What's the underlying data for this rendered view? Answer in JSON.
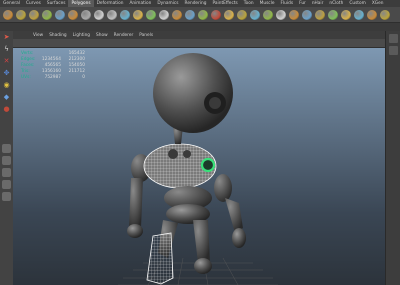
{
  "menu_tabs": [
    "General",
    "Curves",
    "Surfaces",
    "Polygons",
    "Deformation",
    "Animation",
    "Dynamics",
    "Rendering",
    "PaintEffects",
    "Toon",
    "Muscle",
    "Fluids",
    "Fur",
    "nHair",
    "nCloth",
    "Custom",
    "XGen"
  ],
  "active_tab_index": 3,
  "shelf_icon_colors": [
    "#c78a3a",
    "#b9a33c",
    "#bca040",
    "#8fb648",
    "#6aa0c9",
    "#c78a3a",
    "#a9a9a9",
    "#d0d0d0",
    "#bfbfbf",
    "#67b0cd",
    "#d8b14a",
    "#7fbf5a",
    "#d0d0d0",
    "#c78a3a",
    "#6aa0c9",
    "#8fb648",
    "#c04a3a",
    "#d8b14a",
    "#b9a33c",
    "#67b0cd",
    "#8fb648",
    "#d0d0d0",
    "#c78a3a",
    "#6aa0c9",
    "#bca040",
    "#7fbf5a",
    "#d8b14a",
    "#67b0cd",
    "#c78a3a",
    "#b9a33c"
  ],
  "panel_menus": [
    "View",
    "Shading",
    "Lighting",
    "Show",
    "Renderer",
    "Panels"
  ],
  "hud_stats": [
    {
      "label": "Verts:",
      "v1": "",
      "v2": "165432"
    },
    {
      "label": "Edges:",
      "v1": "1234564",
      "v2": "212300"
    },
    {
      "label": "Faces:",
      "v1": "456565",
      "v2": "154050"
    },
    {
      "label": "Tris:",
      "v1": "1356160",
      "v2": "211712"
    },
    {
      "label": "UVs:",
      "v1": "752987",
      "v2": "0"
    }
  ],
  "accent_highlight": "#39e07a",
  "wireframe_color": "#ffffff"
}
